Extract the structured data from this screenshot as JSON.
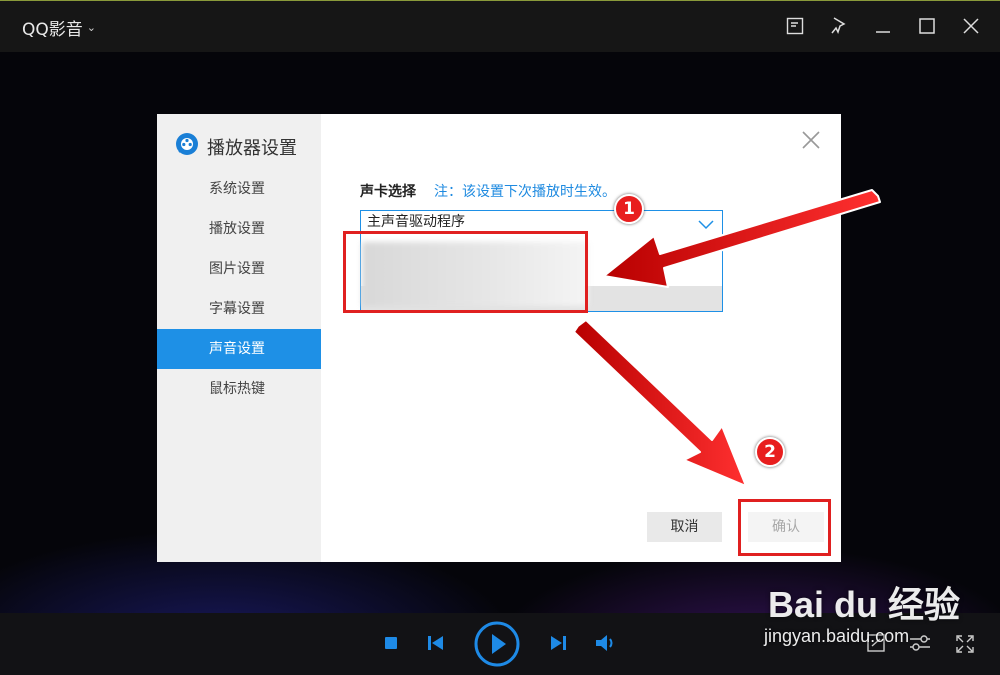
{
  "app": {
    "title": "QQ影音",
    "title_caret": "⌄"
  },
  "dialog": {
    "title": "播放器设置",
    "nav": [
      {
        "label": "系统设置",
        "active": false
      },
      {
        "label": "播放设置",
        "active": false
      },
      {
        "label": "图片设置",
        "active": false
      },
      {
        "label": "字幕设置",
        "active": false
      },
      {
        "label": "声音设置",
        "active": true
      },
      {
        "label": "鼠标热键",
        "active": false
      }
    ],
    "sound_card_label": "声卡选择",
    "sound_card_note": "注：该设置下次播放时生效。",
    "select_value": "主声音驱动程序",
    "cancel_label": "取消",
    "ok_label": "确认"
  },
  "annotations": {
    "badge1": "1",
    "badge2": "2"
  },
  "watermark": {
    "logo": "Bai du 经验",
    "url": "jingyan.baidu.com"
  },
  "colors": {
    "accent": "#1e90e6",
    "annotation_red": "#e02020",
    "titlebar": "#161616"
  }
}
